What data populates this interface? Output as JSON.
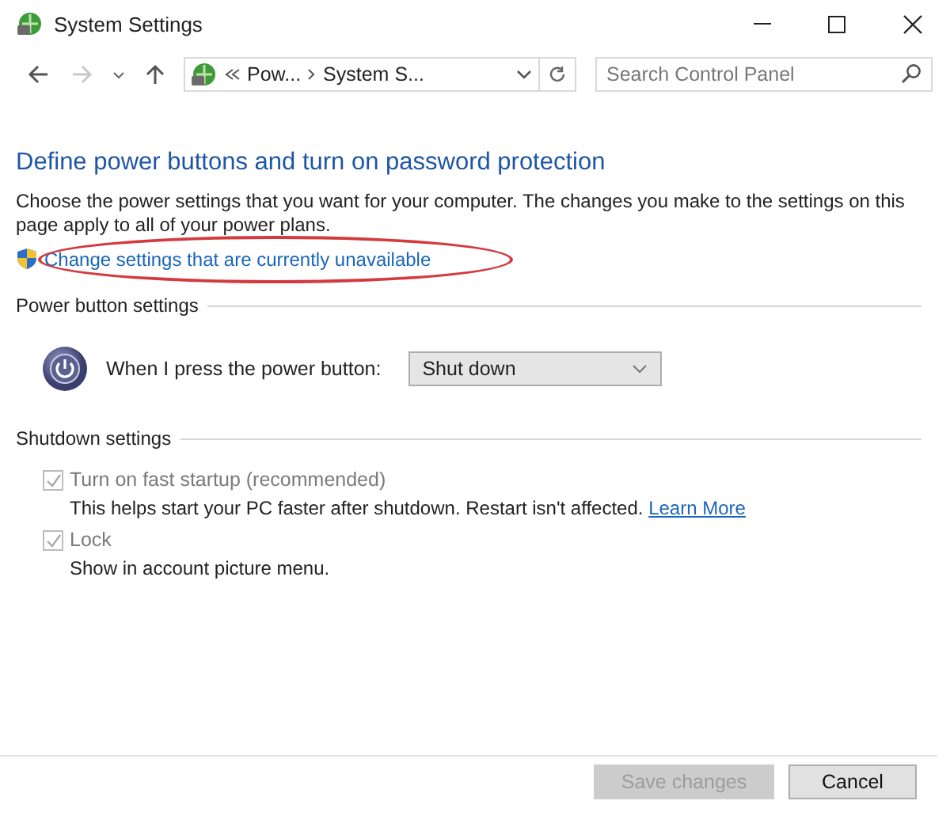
{
  "window": {
    "title": "System Settings"
  },
  "navigation": {
    "back": {
      "disabled": false
    },
    "forward": {
      "disabled": true
    },
    "breadcrumbs": [
      "Pow...",
      "System S..."
    ],
    "search": {
      "placeholder": "Search Control Panel"
    }
  },
  "heading": "Define power buttons and turn on password protection",
  "description": "Choose the power settings that you want for your computer. The changes you make to the settings on this page apply to all of your power plans.",
  "admin_link": {
    "label": "Change settings that are currently unavailable",
    "circled": true
  },
  "power_button_settings": {
    "title": "Power button settings",
    "label": "When I press the power button:",
    "value": "Shut down"
  },
  "shutdown_settings": {
    "title": "Shutdown settings",
    "options": [
      {
        "label": "Turn on fast startup (recommended)",
        "checked": true,
        "disabled": true,
        "description": "This helps start your PC faster after shutdown. Restart isn't affected.",
        "link": "Learn More"
      },
      {
        "label": "Lock",
        "checked": true,
        "disabled": true,
        "description": "Show in account picture menu."
      }
    ]
  },
  "buttons": [
    {
      "label": "Save changes",
      "disabled": true
    },
    {
      "label": "Cancel",
      "disabled": false
    }
  ]
}
